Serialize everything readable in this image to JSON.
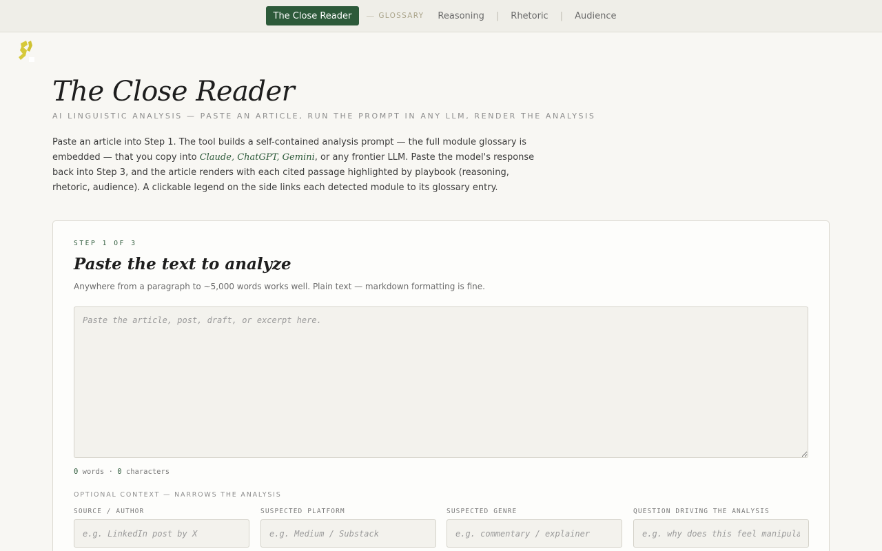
{
  "nav": {
    "brand": "The Close Reader",
    "dash": "—",
    "glossary": "GLOSSARY",
    "links": [
      "Reasoning",
      "Rhetoric",
      "Audience"
    ],
    "separator": "|"
  },
  "header": {
    "title": "The Close Reader",
    "subtitle": "AI LINGUISTIC ANALYSIS — PASTE AN ARTICLE, RUN THE PROMPT IN ANY LLM, RENDER THE ANALYSIS",
    "intro_before": "Paste an article into Step 1. The tool builds a self-contained analysis prompt — the full module glossary is embedded — that you copy into ",
    "intro_llms": "Claude, ChatGPT, Gemini",
    "intro_after": ", or any frontier LLM. Paste the model's response back into Step 3, and the article renders with each cited passage highlighted by playbook (reasoning, rhetoric, audience). A clickable legend on the side links each detected module to its glossary entry."
  },
  "step": {
    "label": "STEP 1 OF 3",
    "title": "Paste the text to analyze",
    "description": "Anywhere from a paragraph to ~5,000 words works well. Plain text — markdown formatting is fine.",
    "textarea_placeholder": "Paste the article, post, draft, or excerpt here.",
    "textarea_value": "",
    "word_count": "0",
    "words_label": " words · ",
    "char_count": "0",
    "chars_label": " characters"
  },
  "context": {
    "title": "OPTIONAL CONTEXT — NARROWS THE ANALYSIS",
    "fields": [
      {
        "label": "SOURCE / AUTHOR",
        "placeholder": "e.g. LinkedIn post by X"
      },
      {
        "label": "SUSPECTED PLATFORM",
        "placeholder": "e.g. Medium / Substack"
      },
      {
        "label": "SUSPECTED GENRE",
        "placeholder": "e.g. commentary / explainer"
      },
      {
        "label": "QUESTION DRIVING THE ANALYSIS",
        "placeholder": "e.g. why does this feel manipulative?"
      }
    ]
  },
  "icons": {
    "logo": "close-reader-logo",
    "logo_color": "#d6c93a"
  },
  "colors": {
    "accent": "#2d5a3a",
    "background": "#f8f7f3"
  }
}
